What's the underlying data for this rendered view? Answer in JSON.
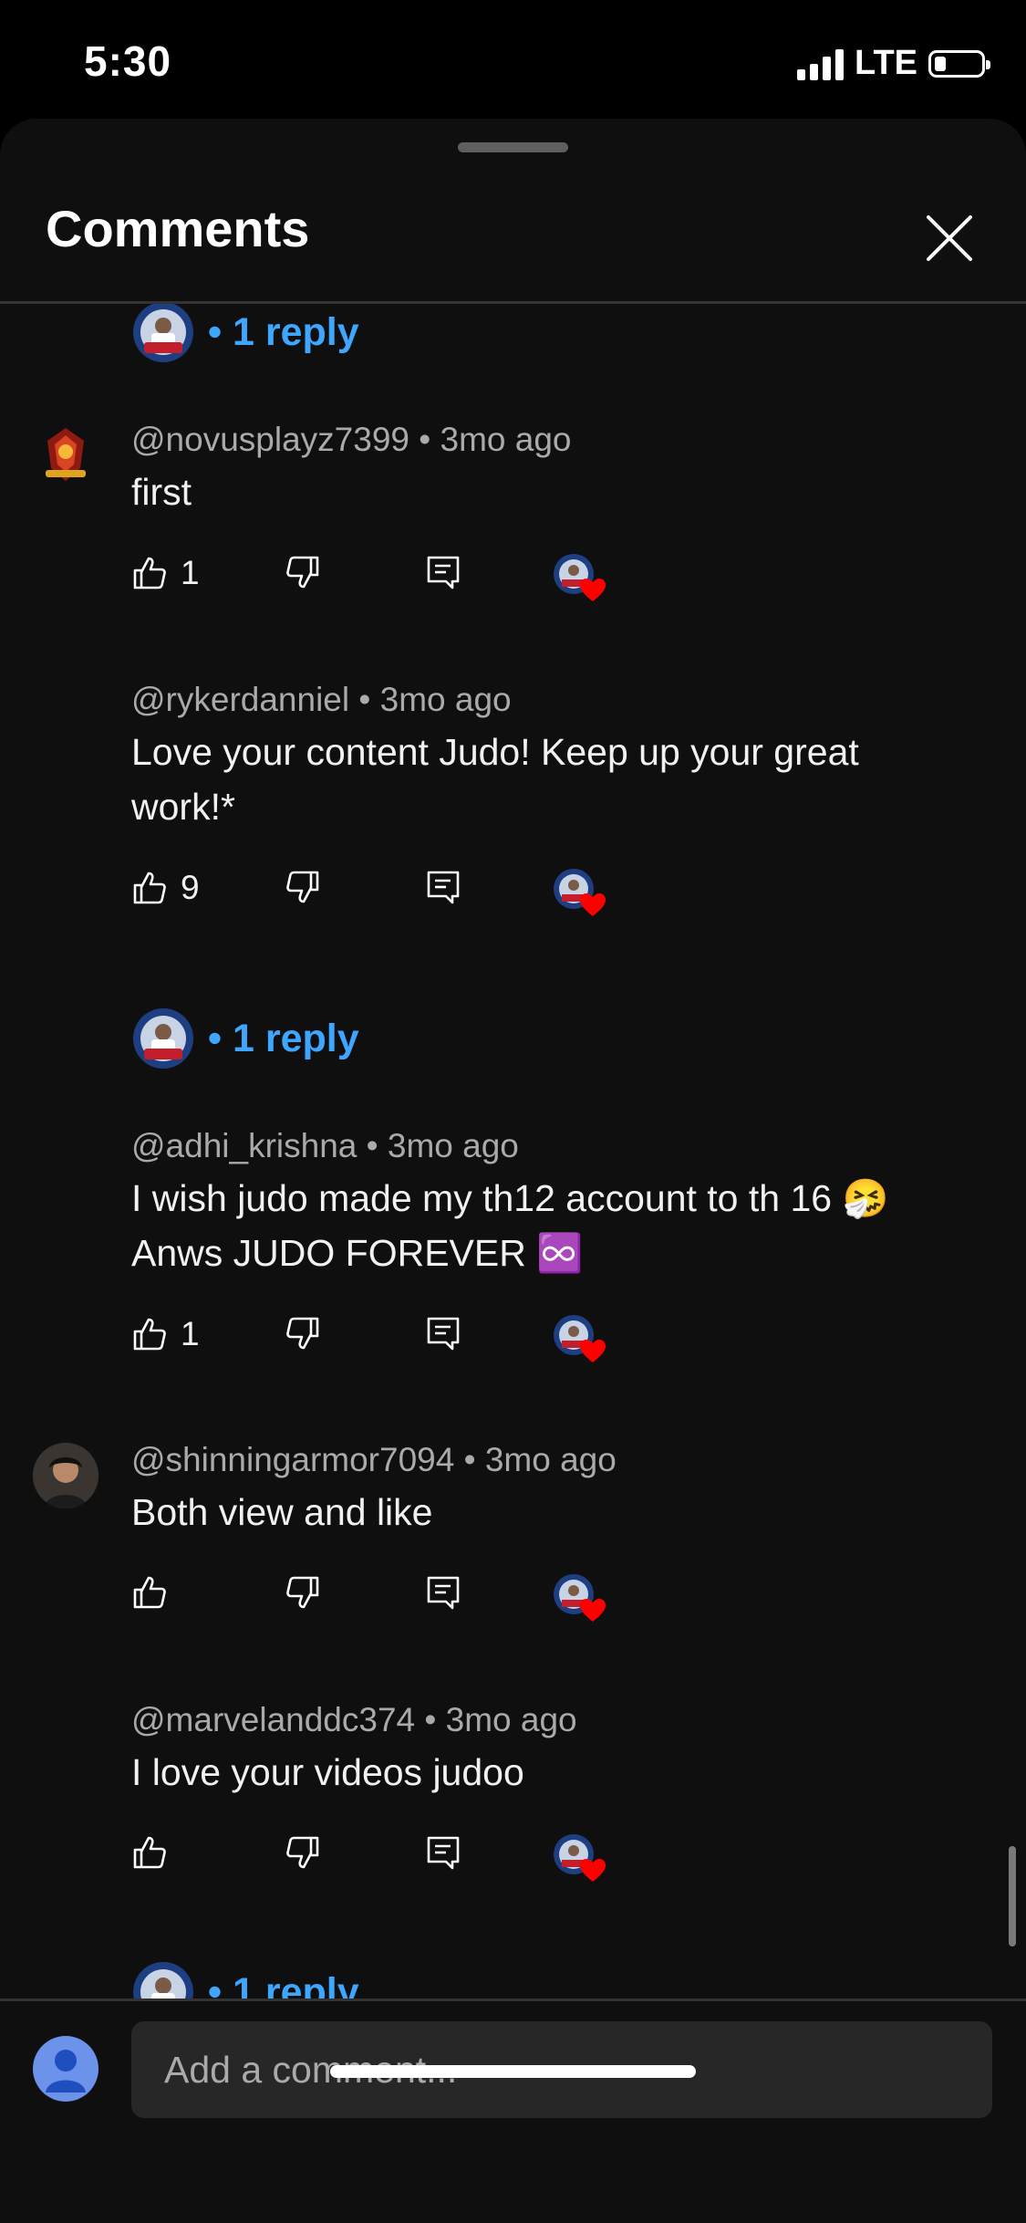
{
  "status_bar": {
    "time": "5:30",
    "network": "LTE"
  },
  "sheet": {
    "title": "Comments"
  },
  "reply_label": "• 1 reply",
  "comments": [
    {
      "author": "@novusplayz7399",
      "age": "3mo ago",
      "text": "first",
      "likes": "1"
    },
    {
      "author": "@rykerdanniel",
      "age": "3mo ago",
      "text": "Love your content Judo! Keep up your great work!*",
      "likes": "9"
    },
    {
      "author": "@adhi_krishna",
      "age": "3mo ago",
      "text": "I wish judo made my th12 account to th 16 🤧 Anws JUDO FOREVER ♾️",
      "likes": "1"
    },
    {
      "author": "@shinningarmor7094",
      "age": "3mo ago",
      "text": "Both view and like",
      "likes": ""
    },
    {
      "author": "@marvelanddc374",
      "age": "3mo ago",
      "text": "I love your videos judoo",
      "likes": ""
    }
  ],
  "input": {
    "placeholder": "Add a comment..."
  },
  "colors": {
    "accent": "#3ea6ff",
    "heart": "#ff0000",
    "background": "#0f0f0f"
  }
}
